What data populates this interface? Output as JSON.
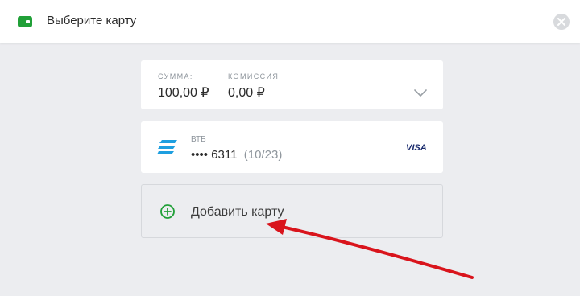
{
  "header": {
    "title": "Выберите карту",
    "icon": "wallet-icon",
    "close_icon": "close-icon"
  },
  "payment": {
    "amount_label": "СУММА:",
    "amount_value": "100,00 ₽",
    "commission_label": "КОМИССИЯ:",
    "commission_value": "0,00 ₽"
  },
  "card": {
    "bank": "ВТБ",
    "number": "•••• 6311",
    "expiry": "(10/23)",
    "network": "VISA"
  },
  "add_card": {
    "label": "Добавить карту",
    "icon": "plus-circle-icon"
  },
  "colors": {
    "accent_green": "#21a038",
    "arrow_red": "#d9141c",
    "bank_blue": "#1e9fe0",
    "visa_navy": "#1a2b6d"
  }
}
